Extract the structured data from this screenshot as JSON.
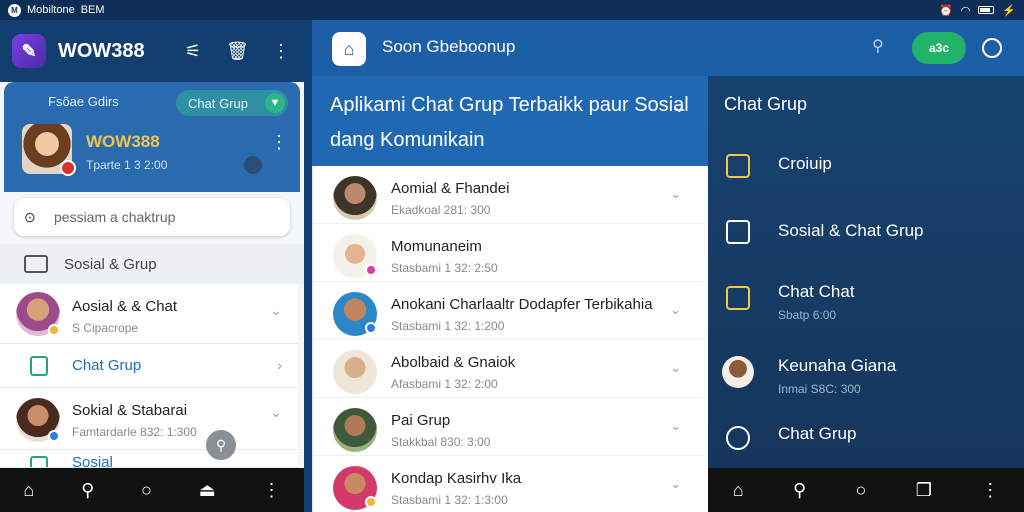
{
  "status_bar": {
    "left_text": "Mobiltone",
    "left_tag": "BEM"
  },
  "left": {
    "app_name": "WOW388",
    "profile": {
      "label": "Fsõae Gdirs",
      "pill": "Chat Grup",
      "name": "WOW388",
      "sub": "Tparte 1 3 2:00"
    },
    "search_placeholder": "pessiam a chaktrup",
    "section": "Sosial & Grup",
    "rows": [
      {
        "title": "Aosial & & Chat",
        "sub": "S Cipacrope"
      },
      {
        "title": "Chat Grup"
      },
      {
        "title": "Sokial & Stabarai",
        "sub": "Famtardarle 832: 1:300"
      },
      {
        "title": "Sosial"
      }
    ]
  },
  "middle": {
    "top_title": "Soon Gbeboonup",
    "pill": "a3c",
    "header": "Aplikami Chat Grup Terbaikk paur Sosial dang Komunikain",
    "rows": [
      {
        "title": "Aomial & Fhandei",
        "sub": "Ekadkoal 281: 300"
      },
      {
        "title": "Momunaneim",
        "sub": "Stasbami 1 32: 2:50"
      },
      {
        "title": "Anokani Charlaaltr Dodapfer Terbikahia",
        "sub": "Stasbami 1 32: 1:200"
      },
      {
        "title": "Abolbaid & Gnaiok",
        "sub": "Afasbami 1 32: 2:00"
      },
      {
        "title": "Pai Grup",
        "sub": "Stakkbal 830: 3:00"
      },
      {
        "title": "Kondap Kasirhv Ika",
        "sub": "Stasbami 1 32: 1:3:00"
      }
    ]
  },
  "right": {
    "header": "Chat Grup",
    "rows": [
      {
        "title": "Croiuip"
      },
      {
        "title": "Sosial & Chat Grup"
      },
      {
        "title": "Chat Chat",
        "sub": "Sbatp 6:00"
      },
      {
        "title": "Keunaha Giana",
        "sub": "Inmai S8C: 300"
      },
      {
        "title": "Chat Grup"
      }
    ]
  },
  "colors": {
    "primary": "#1c5fa6",
    "accent_green": "#22b36a",
    "accent_gold": "#f3c44a"
  }
}
